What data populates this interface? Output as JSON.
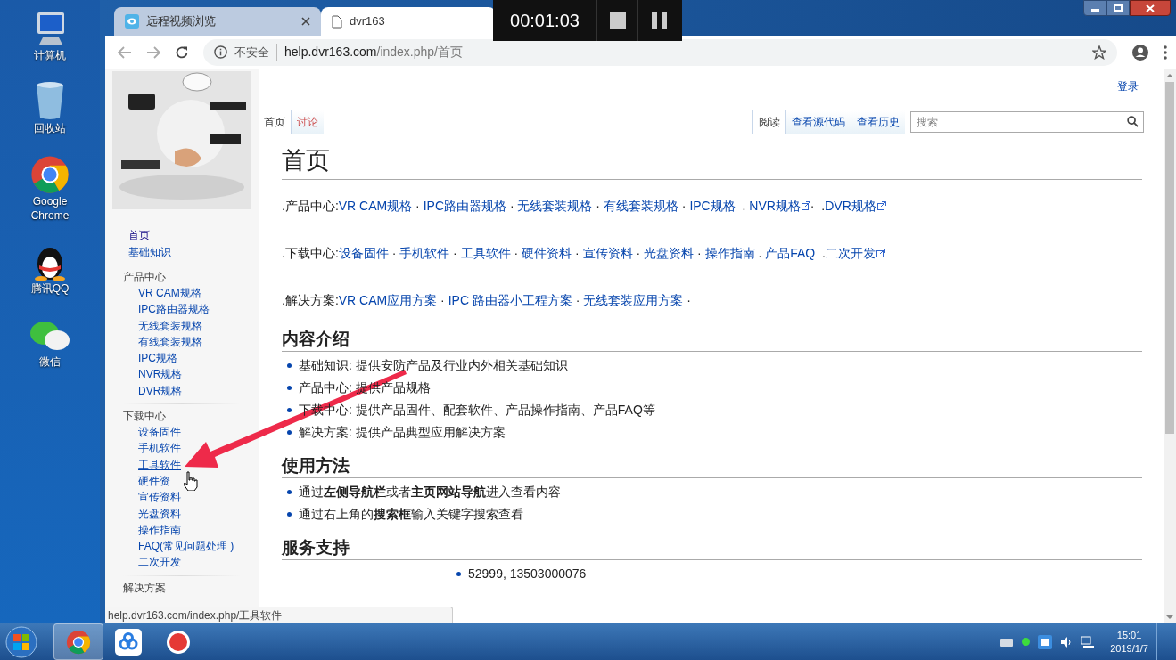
{
  "desktop_icons": [
    {
      "kind": "computer",
      "label": "计算机"
    },
    {
      "kind": "recycle",
      "label": "回收站"
    },
    {
      "kind": "chrome",
      "label": "Google Chrome"
    },
    {
      "kind": "qq",
      "label": "腾讯QQ"
    },
    {
      "kind": "wechat",
      "label": "微信"
    }
  ],
  "recorder": {
    "time": "00:01:03"
  },
  "browser": {
    "tabs": [
      {
        "title": "远程视频浏览",
        "selected": false,
        "closable": true
      },
      {
        "title": "dvr163",
        "selected": true,
        "closable": false
      }
    ],
    "address": {
      "security": "不安全",
      "host": "help.dvr163.com",
      "path": "/index.php/首页"
    }
  },
  "page": {
    "login": "登录",
    "sidebar": {
      "top_links": [
        {
          "label": "首页",
          "hovered": false
        },
        {
          "label": "基础知识",
          "hovered": false
        }
      ],
      "sections": [
        {
          "heading": "产品中心",
          "links": [
            {
              "label": "VR CAM规格",
              "hovered": false
            },
            {
              "label": "IPC路由器规格",
              "hovered": false
            },
            {
              "label": "无线套装规格",
              "hovered": false
            },
            {
              "label": "有线套装规格",
              "hovered": false
            },
            {
              "label": "IPC规格",
              "hovered": false
            },
            {
              "label": "NVR规格",
              "hovered": false
            },
            {
              "label": "DVR规格",
              "hovered": false
            }
          ]
        },
        {
          "heading": "下载中心",
          "links": [
            {
              "label": "设备固件",
              "hovered": false
            },
            {
              "label": "手机软件",
              "hovered": false
            },
            {
              "label": "工具软件",
              "hovered": true
            },
            {
              "label": "硬件资",
              "hovered": false
            },
            {
              "label": "宣传资料",
              "hovered": false
            },
            {
              "label": "光盘资料",
              "hovered": false
            },
            {
              "label": "操作指南",
              "hovered": false
            },
            {
              "label": "FAQ(常见问题处理 )",
              "hovered": false
            },
            {
              "label": "二次开发",
              "hovered": false
            }
          ]
        },
        {
          "heading": "解决方案"
        }
      ]
    },
    "page_tabs": [
      {
        "label": "首页",
        "selected": true,
        "missing": false
      },
      {
        "label": "讨论",
        "selected": false,
        "missing": true
      }
    ],
    "view_tabs": [
      {
        "label": "阅读",
        "selected": true
      },
      {
        "label": "查看源代码",
        "selected": false
      },
      {
        "label": "查看历史",
        "selected": false
      }
    ],
    "search": {
      "placeholder": "搜索"
    },
    "title": "首页",
    "nav_lines": [
      [
        {
          "kind": "text",
          "text": ".产品中心:"
        },
        {
          "kind": "link",
          "text": "VR CAM规格"
        },
        {
          "kind": "text",
          "text": " · "
        },
        {
          "kind": "link",
          "text": "IPC路由器规格"
        },
        {
          "kind": "text",
          "text": " · "
        },
        {
          "kind": "link",
          "text": "无线套装规格"
        },
        {
          "kind": "text",
          "text": " · "
        },
        {
          "kind": "link",
          "text": "有线套装规格"
        },
        {
          "kind": "text",
          "text": " · "
        },
        {
          "kind": "link",
          "text": "IPC规格"
        },
        {
          "kind": "text",
          "text": "  . "
        },
        {
          "kind": "external_link",
          "text": "NVR规格"
        },
        {
          "kind": "text",
          "text": "·  ."
        },
        {
          "kind": "external_link",
          "text": "DVR规格"
        }
      ],
      [
        {
          "kind": "text",
          "text": ".下载中心:"
        },
        {
          "kind": "link",
          "text": "设备固件"
        },
        {
          "kind": "text",
          "text": " · "
        },
        {
          "kind": "link",
          "text": "手机软件"
        },
        {
          "kind": "text",
          "text": " · "
        },
        {
          "kind": "link",
          "text": "工具软件"
        },
        {
          "kind": "text",
          "text": " · "
        },
        {
          "kind": "link",
          "text": "硬件资料"
        },
        {
          "kind": "text",
          "text": " · "
        },
        {
          "kind": "link",
          "text": "宣传资料"
        },
        {
          "kind": "text",
          "text": " · "
        },
        {
          "kind": "link",
          "text": "光盘资料"
        },
        {
          "kind": "text",
          "text": " · "
        },
        {
          "kind": "link",
          "text": "操作指南"
        },
        {
          "kind": "text",
          "text": " . "
        },
        {
          "kind": "link",
          "text": "产品FAQ"
        },
        {
          "kind": "text",
          "text": "  ."
        },
        {
          "kind": "external_link",
          "text": "二次开发"
        }
      ],
      [
        {
          "kind": "text",
          "text": ".解决方案:"
        },
        {
          "kind": "link",
          "text": "VR CAM应用方案"
        },
        {
          "kind": "text",
          "text": " · "
        },
        {
          "kind": "link",
          "text": "IPC 路由器小工程方案"
        },
        {
          "kind": "text",
          "text": " · "
        },
        {
          "kind": "link",
          "text": "无线套装应用方案"
        },
        {
          "kind": "text",
          "text": " ·"
        }
      ]
    ],
    "sections": [
      {
        "heading": "内容介绍",
        "items": [
          "基础知识: 提供安防产品及行业内外相关基础知识",
          "产品中心: 提供产品规格",
          "下载中心: 提供产品固件、配套软件、产品操作指南、产品FAQ等",
          "解决方案: 提供产品典型应用解决方案"
        ]
      },
      {
        "heading": "使用方法",
        "items": [
          "通过**左侧导航栏**或者**主页网站导航**进入查看内容",
          "通过右上角的**搜索框**输入关键字搜索查看"
        ]
      },
      {
        "heading": "服务支持",
        "items": [
          "52999, 13503000076"
        ]
      }
    ]
  },
  "status_bubble": "help.dvr163.com/index.php/工具软件",
  "taskbar": {
    "apps": [
      {
        "kind": "chrome",
        "selected": true
      },
      {
        "kind": "cloud",
        "selected": false
      },
      {
        "kind": "record",
        "selected": false
      }
    ],
    "clock": {
      "time": "15:01",
      "date": "2019/1/7"
    }
  }
}
